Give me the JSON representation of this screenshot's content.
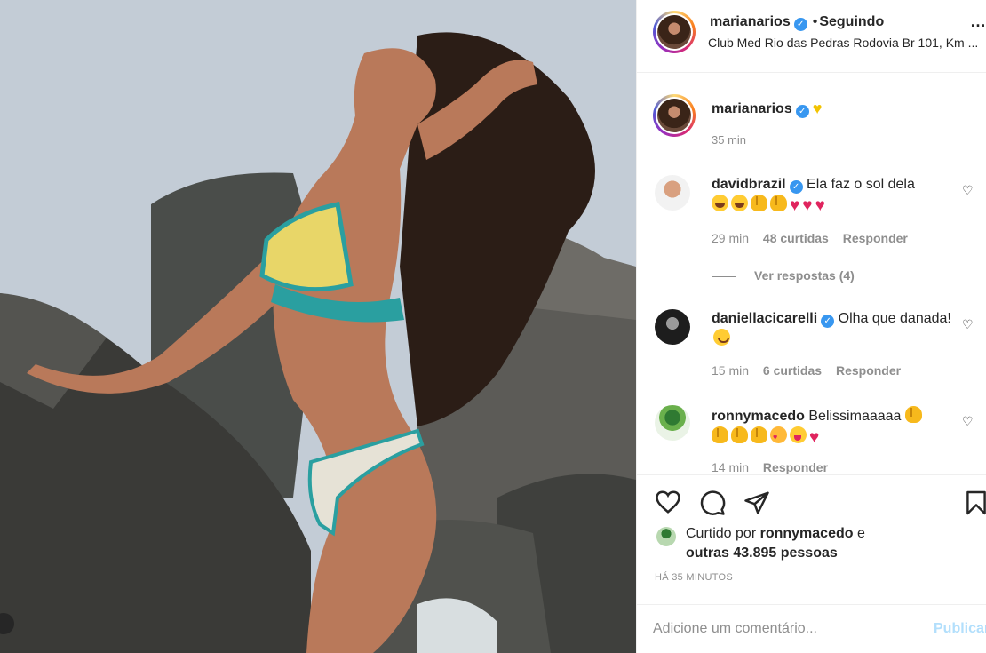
{
  "post": {
    "author": "marianarios",
    "follow_state": "Seguindo",
    "location": "Club Med Rio das Pedras Rodovia Br 101, Km ...",
    "more_icon": "more-options-icon"
  },
  "caption": {
    "author": "marianarios",
    "emoji": "yellow-heart-icon",
    "time": "35 min"
  },
  "comments": [
    {
      "author": "davidbrazil",
      "text": "Ela faz o sol dela",
      "emojis": [
        "laugh",
        "laugh",
        "clap",
        "clap",
        "heart",
        "heart",
        "heart"
      ],
      "time": "29 min",
      "likes": "48 curtidas",
      "reply": "Responder",
      "view_replies": "Ver respostas (4)"
    },
    {
      "author": "daniellacicarelli",
      "text": "Olha que danada!",
      "time": "15 min",
      "likes": "6 curtidas",
      "reply": "Responder"
    },
    {
      "author": "ronnymacedo",
      "text": "Belissimaaaaa",
      "time": "14 min",
      "reply": "Responder"
    }
  ],
  "liked_by": {
    "prefix": "Curtido por",
    "user": "ronnymacedo",
    "conj": "e",
    "others": "outras 43.895 pessoas"
  },
  "timestamp": "HÁ 35 MINUTOS",
  "composer": {
    "placeholder": "Adicione um comentário...",
    "publish": "Publicar"
  },
  "colors": {
    "verified": "#3897f0",
    "muted": "#8e8e8e",
    "publish_disabled": "#b2dffc",
    "heart_red": "#e0245e"
  }
}
